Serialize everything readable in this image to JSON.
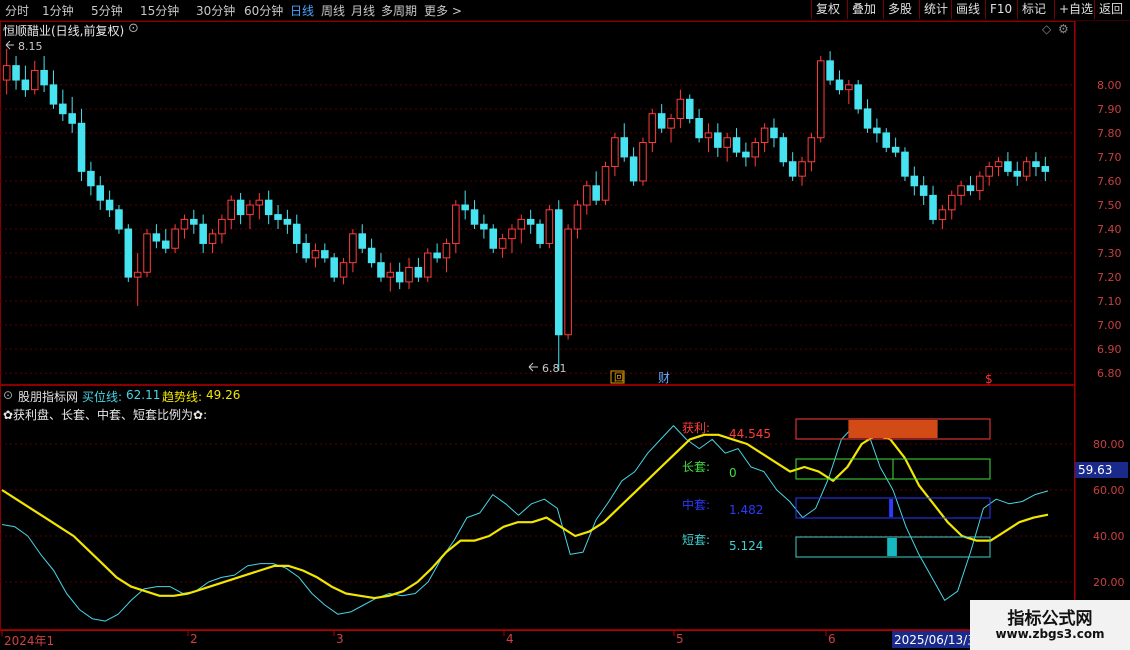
{
  "toolbar": {
    "periods": [
      "分时",
      "1分钟",
      "5分钟",
      "15分钟",
      "30分钟",
      "60分钟",
      "日线",
      "周线",
      "月线",
      "多周期",
      "更多 >"
    ],
    "active_period": "日线",
    "tools": [
      "复权",
      "叠加",
      "多股",
      "统计",
      "画线",
      "F10",
      "标记",
      "+自选",
      "返回"
    ]
  },
  "main": {
    "title": "恒顺醋业(日线,前复权)",
    "high_label": "8.15",
    "low_label": "6.81",
    "event_markers": [
      "回",
      "财",
      "$"
    ]
  },
  "indicator": {
    "name": "股朋指标网",
    "buy_label": "买位线:",
    "buy_value": "62.11",
    "trend_label": "趋势线:",
    "trend_value": "49.26",
    "desc": "✿获利盘、长套、中套、短套比例为✿:",
    "current_value": "59.63",
    "bars": [
      {
        "label": "获利:",
        "value": "44.545",
        "color": "#ff3b3b"
      },
      {
        "label": "长套:",
        "value": "0",
        "color": "#40e040"
      },
      {
        "label": "中套:",
        "value": "1.482",
        "color": "#2a3aff"
      },
      {
        "label": "短套:",
        "value": "5.124",
        "color": "#40d0d0"
      }
    ]
  },
  "time_axis": {
    "labels": [
      "2024年1",
      "2",
      "3",
      "4",
      "5",
      "6"
    ],
    "current_date": "2025/06/13/五"
  },
  "watermark": {
    "title": "指标公式网",
    "url": "www.zbgs3.com"
  },
  "colors": {
    "up": "#ff3b3b",
    "down": "#48e3f0",
    "buy_line": "#47d6e6",
    "trend_line": "#f2e600",
    "grid": "#5a0000",
    "axis": "#b00000"
  },
  "chart_data": [
    {
      "type": "candlestick",
      "title": "恒顺醋业(日线,前复权)",
      "ylim": [
        6.78,
        8.22
      ],
      "y_ticks": [
        "8.00",
        "7.90",
        "7.80",
        "7.70",
        "7.60",
        "7.50",
        "7.40",
        "7.30",
        "7.20",
        "7.10",
        "7.00",
        "6.90",
        "6.80"
      ],
      "ohlc": [
        [
          8.02,
          8.15,
          7.96,
          8.08
        ],
        [
          8.08,
          8.12,
          7.98,
          8.02
        ],
        [
          8.02,
          8.08,
          7.95,
          7.98
        ],
        [
          7.98,
          8.1,
          7.96,
          8.06
        ],
        [
          8.06,
          8.12,
          7.97,
          8.0
        ],
        [
          8.0,
          8.06,
          7.9,
          7.92
        ],
        [
          7.92,
          7.98,
          7.85,
          7.88
        ],
        [
          7.88,
          7.95,
          7.8,
          7.84
        ],
        [
          7.84,
          7.9,
          7.6,
          7.64
        ],
        [
          7.64,
          7.68,
          7.54,
          7.58
        ],
        [
          7.58,
          7.62,
          7.48,
          7.52
        ],
        [
          7.52,
          7.56,
          7.45,
          7.48
        ],
        [
          7.48,
          7.5,
          7.38,
          7.4
        ],
        [
          7.4,
          7.42,
          7.18,
          7.2
        ],
        [
          7.2,
          7.3,
          7.08,
          7.22
        ],
        [
          7.22,
          7.4,
          7.2,
          7.38
        ],
        [
          7.38,
          7.42,
          7.32,
          7.35
        ],
        [
          7.35,
          7.4,
          7.3,
          7.32
        ],
        [
          7.32,
          7.42,
          7.3,
          7.4
        ],
        [
          7.4,
          7.46,
          7.36,
          7.44
        ],
        [
          7.44,
          7.48,
          7.38,
          7.42
        ],
        [
          7.42,
          7.46,
          7.3,
          7.34
        ],
        [
          7.34,
          7.4,
          7.3,
          7.38
        ],
        [
          7.38,
          7.46,
          7.34,
          7.44
        ],
        [
          7.44,
          7.54,
          7.4,
          7.52
        ],
        [
          7.52,
          7.55,
          7.42,
          7.46
        ],
        [
          7.46,
          7.52,
          7.4,
          7.5
        ],
        [
          7.5,
          7.55,
          7.44,
          7.52
        ],
        [
          7.52,
          7.56,
          7.42,
          7.46
        ],
        [
          7.46,
          7.5,
          7.4,
          7.44
        ],
        [
          7.44,
          7.48,
          7.38,
          7.42
        ],
        [
          7.42,
          7.46,
          7.3,
          7.34
        ],
        [
          7.34,
          7.38,
          7.26,
          7.28
        ],
        [
          7.28,
          7.34,
          7.24,
          7.31
        ],
        [
          7.31,
          7.34,
          7.26,
          7.28
        ],
        [
          7.28,
          7.3,
          7.18,
          7.2
        ],
        [
          7.2,
          7.28,
          7.17,
          7.26
        ],
        [
          7.26,
          7.4,
          7.22,
          7.38
        ],
        [
          7.38,
          7.42,
          7.3,
          7.32
        ],
        [
          7.32,
          7.36,
          7.24,
          7.26
        ],
        [
          7.26,
          7.3,
          7.18,
          7.2
        ],
        [
          7.2,
          7.26,
          7.14,
          7.22
        ],
        [
          7.22,
          7.26,
          7.15,
          7.18
        ],
        [
          7.18,
          7.28,
          7.15,
          7.24
        ],
        [
          7.24,
          7.28,
          7.18,
          7.2
        ],
        [
          7.2,
          7.32,
          7.18,
          7.3
        ],
        [
          7.3,
          7.34,
          7.26,
          7.28
        ],
        [
          7.28,
          7.36,
          7.22,
          7.34
        ],
        [
          7.34,
          7.52,
          7.3,
          7.5
        ],
        [
          7.5,
          7.56,
          7.44,
          7.48
        ],
        [
          7.48,
          7.52,
          7.4,
          7.42
        ],
        [
          7.42,
          7.46,
          7.36,
          7.4
        ],
        [
          7.4,
          7.42,
          7.3,
          7.32
        ],
        [
          7.32,
          7.38,
          7.28,
          7.36
        ],
        [
          7.36,
          7.42,
          7.3,
          7.4
        ],
        [
          7.4,
          7.46,
          7.34,
          7.44
        ],
        [
          7.44,
          7.48,
          7.38,
          7.42
        ],
        [
          7.42,
          7.44,
          7.32,
          7.34
        ],
        [
          7.34,
          7.5,
          7.32,
          7.48
        ],
        [
          7.48,
          7.52,
          6.81,
          6.96
        ],
        [
          6.96,
          7.42,
          6.94,
          7.4
        ],
        [
          7.4,
          7.52,
          7.36,
          7.5
        ],
        [
          7.5,
          7.6,
          7.46,
          7.58
        ],
        [
          7.58,
          7.64,
          7.5,
          7.52
        ],
        [
          7.52,
          7.68,
          7.5,
          7.66
        ],
        [
          7.66,
          7.8,
          7.62,
          7.78
        ],
        [
          7.78,
          7.84,
          7.68,
          7.7
        ],
        [
          7.7,
          7.74,
          7.58,
          7.6
        ],
        [
          7.6,
          7.78,
          7.58,
          7.76
        ],
        [
          7.76,
          7.9,
          7.72,
          7.88
        ],
        [
          7.88,
          7.92,
          7.8,
          7.82
        ],
        [
          7.82,
          7.88,
          7.76,
          7.86
        ],
        [
          7.86,
          7.98,
          7.82,
          7.94
        ],
        [
          7.94,
          7.96,
          7.84,
          7.86
        ],
        [
          7.86,
          7.9,
          7.76,
          7.78
        ],
        [
          7.78,
          7.84,
          7.72,
          7.8
        ],
        [
          7.8,
          7.84,
          7.7,
          7.74
        ],
        [
          7.74,
          7.8,
          7.68,
          7.78
        ],
        [
          7.78,
          7.82,
          7.7,
          7.72
        ],
        [
          7.72,
          7.76,
          7.66,
          7.7
        ],
        [
          7.7,
          7.78,
          7.66,
          7.76
        ],
        [
          7.76,
          7.84,
          7.72,
          7.82
        ],
        [
          7.82,
          7.86,
          7.74,
          7.78
        ],
        [
          7.78,
          7.8,
          7.66,
          7.68
        ],
        [
          7.68,
          7.72,
          7.6,
          7.62
        ],
        [
          7.62,
          7.7,
          7.58,
          7.68
        ],
        [
          7.68,
          7.8,
          7.64,
          7.78
        ],
        [
          7.78,
          8.12,
          7.76,
          8.1
        ],
        [
          8.1,
          8.14,
          8.0,
          8.02
        ],
        [
          8.02,
          8.06,
          7.96,
          7.98
        ],
        [
          7.98,
          8.02,
          7.92,
          8.0
        ],
        [
          8.0,
          8.02,
          7.88,
          7.9
        ],
        [
          7.9,
          7.94,
          7.8,
          7.82
        ],
        [
          7.82,
          7.86,
          7.76,
          7.8
        ],
        [
          7.8,
          7.82,
          7.72,
          7.74
        ],
        [
          7.74,
          7.78,
          7.7,
          7.72
        ],
        [
          7.72,
          7.74,
          7.6,
          7.62
        ],
        [
          7.62,
          7.66,
          7.54,
          7.58
        ],
        [
          7.58,
          7.62,
          7.5,
          7.54
        ],
        [
          7.54,
          7.58,
          7.42,
          7.44
        ],
        [
          7.44,
          7.5,
          7.4,
          7.48
        ],
        [
          7.48,
          7.56,
          7.44,
          7.54
        ],
        [
          7.54,
          7.6,
          7.5,
          7.58
        ],
        [
          7.58,
          7.62,
          7.54,
          7.56
        ],
        [
          7.56,
          7.64,
          7.52,
          7.62
        ],
        [
          7.62,
          7.68,
          7.58,
          7.66
        ],
        [
          7.66,
          7.7,
          7.62,
          7.68
        ],
        [
          7.68,
          7.72,
          7.62,
          7.64
        ],
        [
          7.64,
          7.68,
          7.58,
          7.62
        ],
        [
          7.62,
          7.7,
          7.6,
          7.68
        ],
        [
          7.68,
          7.72,
          7.62,
          7.66
        ],
        [
          7.66,
          7.7,
          7.6,
          7.64
        ]
      ]
    },
    {
      "type": "line",
      "title": "股朋指标网",
      "ylim": [
        0,
        100
      ],
      "y_ticks": [
        "80.00",
        "60.00",
        "40.00",
        "20.00"
      ],
      "series": [
        {
          "name": "买位线",
          "values": [
            45,
            44,
            40,
            32,
            25,
            15,
            8,
            4,
            3,
            6,
            12,
            17,
            18,
            18,
            15,
            16,
            20,
            22,
            23,
            27,
            28,
            28,
            26,
            22,
            15,
            10,
            6,
            7,
            10,
            13,
            15,
            14,
            15,
            20,
            30,
            38,
            48,
            50,
            58,
            54,
            49,
            54,
            56,
            52,
            32,
            33,
            47,
            55,
            64,
            68,
            76,
            82,
            88,
            82,
            78,
            82,
            76,
            78,
            70,
            68,
            60,
            55,
            48,
            52,
            65,
            82,
            88,
            86,
            70,
            60,
            44,
            32,
            22,
            12,
            16,
            33,
            52,
            56,
            54,
            55,
            58,
            59.63
          ]
        },
        {
          "name": "趋势线",
          "values": [
            60,
            56,
            52,
            48,
            44,
            40,
            34,
            28,
            22,
            18,
            16,
            14,
            14,
            15,
            17,
            19,
            21,
            23,
            25,
            27,
            27,
            25,
            22,
            18,
            15,
            14,
            13,
            14,
            16,
            20,
            26,
            33,
            38,
            38,
            40,
            44,
            46,
            46,
            48,
            44,
            40,
            42,
            46,
            52,
            58,
            64,
            70,
            76,
            82,
            84,
            84,
            82,
            80,
            76,
            72,
            68,
            70,
            68,
            64,
            70,
            80,
            84,
            82,
            74,
            62,
            54,
            46,
            40,
            38,
            38,
            42,
            46,
            48,
            49.26
          ]
        }
      ]
    }
  ]
}
